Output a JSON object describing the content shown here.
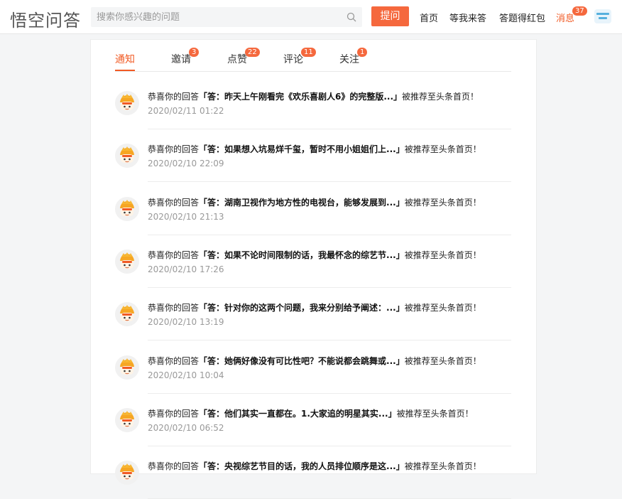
{
  "header": {
    "logo_text": "悟空问答",
    "search_placeholder": "搜索你感兴趣的问题",
    "ask_label": "提问",
    "nav": {
      "home": "首页",
      "wait_answer": "等我来答",
      "red_packet": "答题得红包",
      "messages": "消息",
      "messages_count": "37"
    }
  },
  "tabs": [
    {
      "label": "通知",
      "count": "",
      "active": true
    },
    {
      "label": "邀请",
      "count": "3"
    },
    {
      "label": "点赞",
      "count": "22"
    },
    {
      "label": "评论",
      "count": "11"
    },
    {
      "label": "关注",
      "count": "1"
    }
  ],
  "notifications": [
    {
      "prefix": "恭喜你的回答",
      "quote": "「答：昨天上午刚看完《欢乐喜剧人6》的完整版...」",
      "suffix": "被推荐至头条首页！",
      "time": "2020/02/11 01:22"
    },
    {
      "prefix": "恭喜你的回答",
      "quote": "「答：如果想入坑易烊千玺，暂时不用小姐姐们上...」",
      "suffix": "被推荐至头条首页！",
      "time": "2020/02/10 22:09"
    },
    {
      "prefix": "恭喜你的回答",
      "quote": "「答：湖南卫视作为地方性的电视台，能够发展到...」",
      "suffix": "被推荐至头条首页！",
      "time": "2020/02/10 21:13"
    },
    {
      "prefix": "恭喜你的回答",
      "quote": "「答：如果不论时间限制的话，我最怀念的综艺节...」",
      "suffix": "被推荐至头条首页！",
      "time": "2020/02/10 17:26"
    },
    {
      "prefix": "恭喜你的回答",
      "quote": "「答：针对你的这两个问题，我来分别给予阐述：...」",
      "suffix": "被推荐至头条首页！",
      "time": "2020/02/10 13:19"
    },
    {
      "prefix": "恭喜你的回答",
      "quote": "「答：她俩好像没有可比性吧？不能说都会跳舞或...」",
      "suffix": "被推荐至头条首页！",
      "time": "2020/02/10 10:04"
    },
    {
      "prefix": "恭喜你的回答",
      "quote": "「答：他们其实一直都在。1.大家追的明星其实...」",
      "suffix": "被推荐至头条首页！",
      "time": "2020/02/10 06:52"
    },
    {
      "prefix": "恭喜你的回答",
      "quote": "「答：央视综艺节目的话，我的人员排位顺序是这...」",
      "suffix": "被推荐至头条首页！",
      "time": ""
    }
  ],
  "colors": {
    "accent": "#f15a24",
    "button": "#f5683d"
  }
}
